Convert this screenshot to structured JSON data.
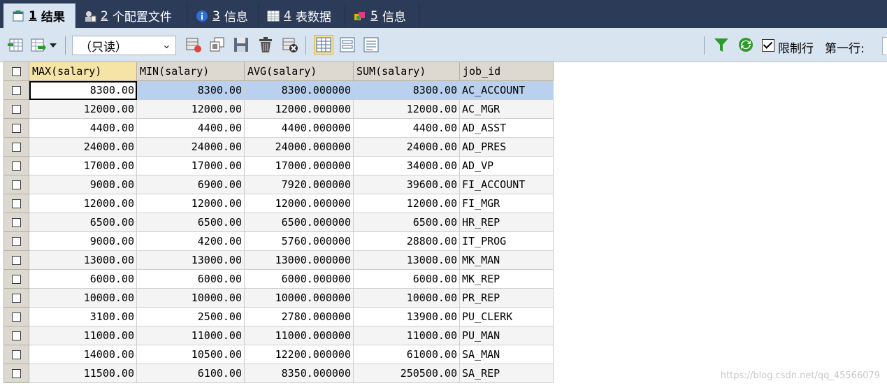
{
  "tabs": [
    {
      "num": "1",
      "label": "结果",
      "icon": "result-grid-icon",
      "active": true
    },
    {
      "num": "2",
      "label": "个配置文件",
      "icon": "profile-icon",
      "active": false
    },
    {
      "num": "3",
      "label": "信息",
      "icon": "info-icon",
      "active": false
    },
    {
      "num": "4",
      "label": "表数据",
      "icon": "table-data-icon",
      "active": false
    },
    {
      "num": "5",
      "label": "信息",
      "icon": "info-puzzle-icon",
      "active": false
    }
  ],
  "toolbar": {
    "mode_select": "（只读）",
    "limit_rows_label": "限制行",
    "first_row_label": "第一行:",
    "limit_rows_checked": true
  },
  "grid": {
    "columns": [
      "MAX(salary)",
      "MIN(salary)",
      "AVG(salary)",
      "SUM(salary)",
      "job_id"
    ],
    "rows": [
      [
        "8300.00",
        "8300.00",
        "8300.000000",
        "8300.00",
        "AC_ACCOUNT"
      ],
      [
        "12000.00",
        "12000.00",
        "12000.000000",
        "12000.00",
        "AC_MGR"
      ],
      [
        "4400.00",
        "4400.00",
        "4400.000000",
        "4400.00",
        "AD_ASST"
      ],
      [
        "24000.00",
        "24000.00",
        "24000.000000",
        "24000.00",
        "AD_PRES"
      ],
      [
        "17000.00",
        "17000.00",
        "17000.000000",
        "34000.00",
        "AD_VP"
      ],
      [
        "9000.00",
        "6900.00",
        "7920.000000",
        "39600.00",
        "FI_ACCOUNT"
      ],
      [
        "12000.00",
        "12000.00",
        "12000.000000",
        "12000.00",
        "FI_MGR"
      ],
      [
        "6500.00",
        "6500.00",
        "6500.000000",
        "6500.00",
        "HR_REP"
      ],
      [
        "9000.00",
        "4200.00",
        "5760.000000",
        "28800.00",
        "IT_PROG"
      ],
      [
        "13000.00",
        "13000.00",
        "13000.000000",
        "13000.00",
        "MK_MAN"
      ],
      [
        "6000.00",
        "6000.00",
        "6000.000000",
        "6000.00",
        "MK_REP"
      ],
      [
        "10000.00",
        "10000.00",
        "10000.000000",
        "10000.00",
        "PR_REP"
      ],
      [
        "3100.00",
        "2500.00",
        "2780.000000",
        "13900.00",
        "PU_CLERK"
      ],
      [
        "11000.00",
        "11000.00",
        "11000.000000",
        "11000.00",
        "PU_MAN"
      ],
      [
        "14000.00",
        "10500.00",
        "12200.000000",
        "61000.00",
        "SA_MAN"
      ],
      [
        "11500.00",
        "6100.00",
        "8350.000000",
        "250500.00",
        "SA_REP"
      ]
    ]
  },
  "watermark": "https://blog.csdn.net/qq_45566079"
}
